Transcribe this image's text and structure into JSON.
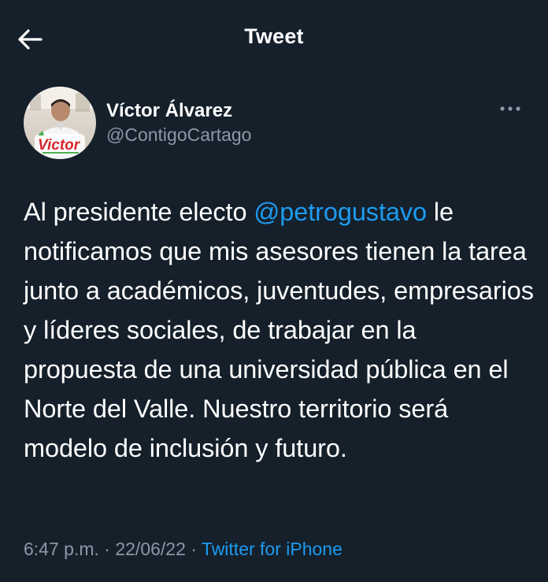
{
  "header": {
    "title": "Tweet",
    "back_icon": "arrow-left-icon"
  },
  "author": {
    "name": "Víctor Álvarez",
    "handle": "@ContigoCartago",
    "avatar_logo_text": "Victor",
    "more_icon": "more-dots-icon"
  },
  "tweet": {
    "text_before": "Al presidente electo ",
    "mention": "@petrogustavo",
    "text_after": " le notificamos que mis asesores tienen la tarea junto a académicos, juventudes, empresarios y líderes sociales, de trabajar en la propuesta de una universidad pública en el Norte del Valle. Nuestro territorio será modelo de inclusión y futuro."
  },
  "meta": {
    "time": "6:47 p.m.",
    "separator": "·",
    "date": "22/06/22",
    "source": "Twitter for iPhone"
  },
  "colors": {
    "background": "#15202b",
    "accent": "#1d9bf0",
    "secondary_text": "#8b98a5"
  }
}
